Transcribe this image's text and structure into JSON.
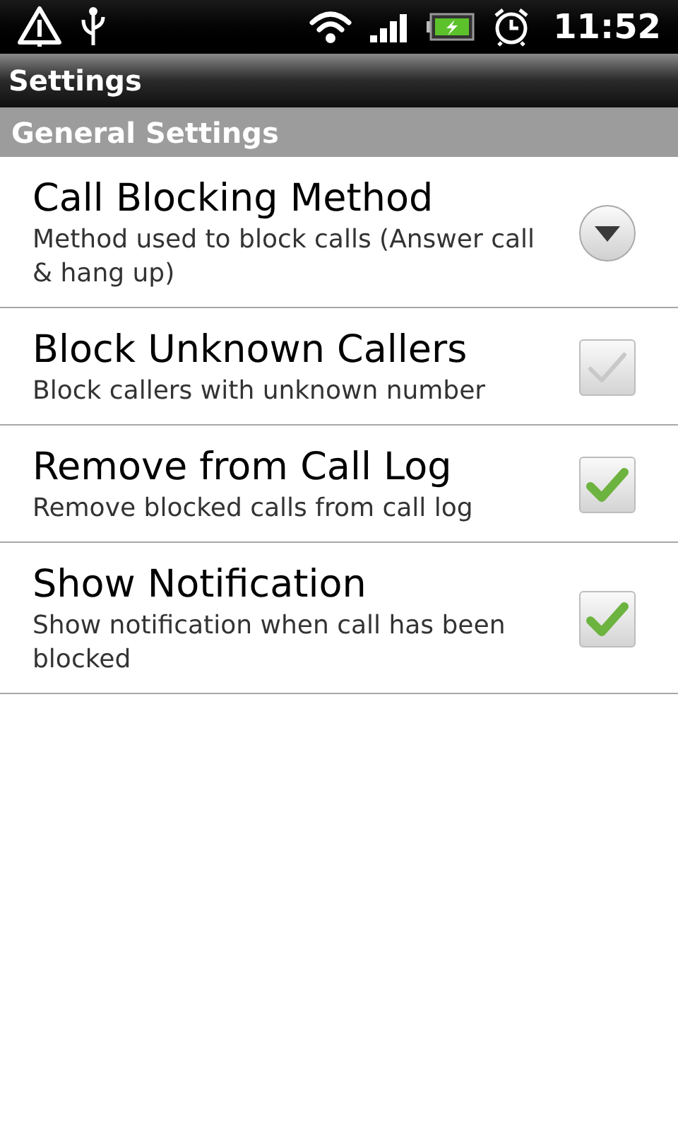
{
  "status_bar": {
    "time": "11:52"
  },
  "title_bar": {
    "title": "Settings"
  },
  "section": {
    "title": "General Settings"
  },
  "settings": [
    {
      "kind": "dropdown",
      "title": "Call Blocking Method",
      "summary": "Method used to block calls (Answer call & hang up)"
    },
    {
      "kind": "checkbox",
      "title": "Block Unknown Callers",
      "summary": "Block callers with unknown number",
      "checked": false
    },
    {
      "kind": "checkbox",
      "title": "Remove from Call Log",
      "summary": "Remove blocked calls from call log",
      "checked": true
    },
    {
      "kind": "checkbox",
      "title": "Show Notification",
      "summary": "Show notification when call has been blocked",
      "checked": true
    }
  ]
}
